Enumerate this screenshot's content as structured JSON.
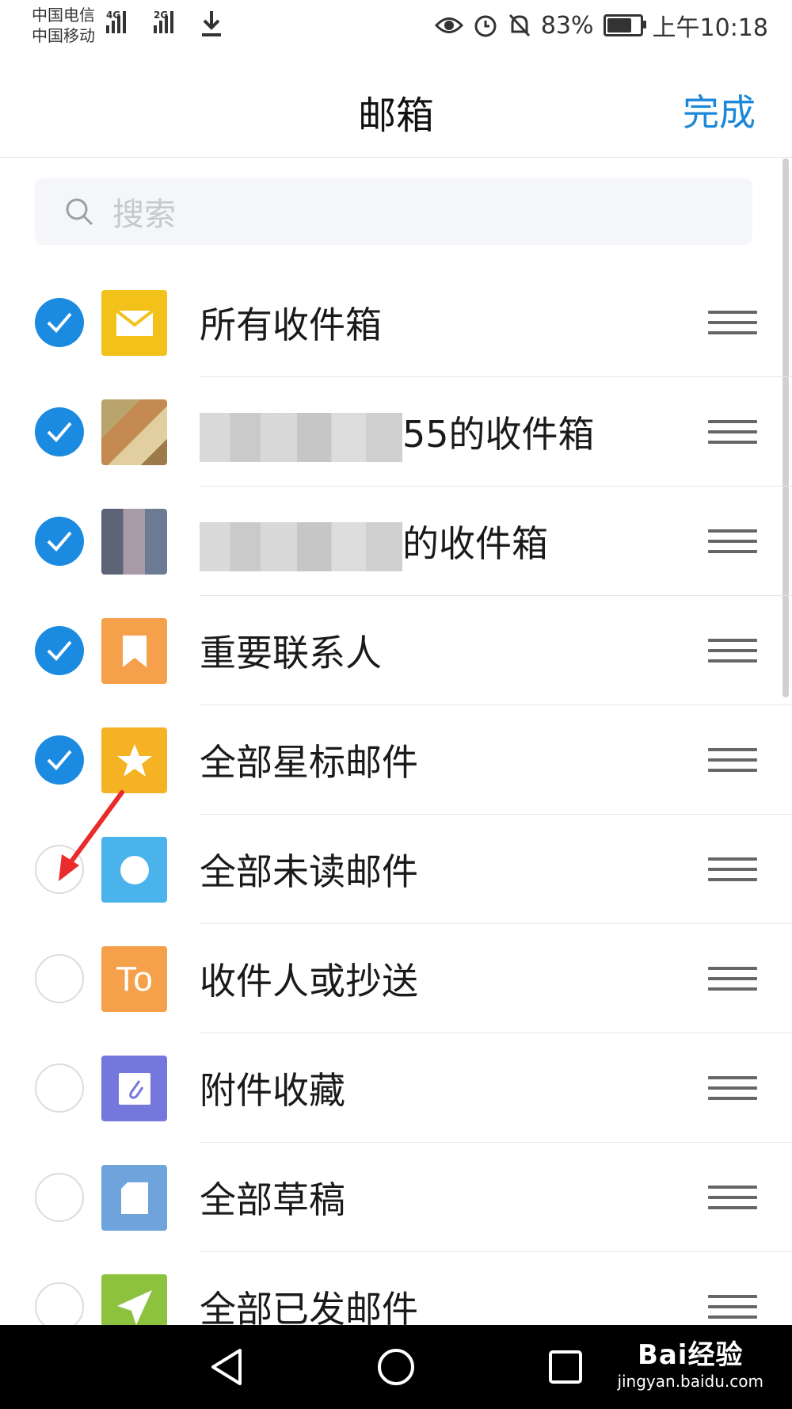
{
  "status_bar": {
    "carrier_1": "中国电信",
    "carrier_2": "中国移动",
    "net_1": "4G",
    "net_2": "2G",
    "battery": "83%",
    "battery_level": 0.83,
    "time": "上午10:18"
  },
  "header": {
    "title": "邮箱",
    "done_label": "完成"
  },
  "search": {
    "placeholder": "搜索"
  },
  "mailboxes": [
    {
      "label": "所有收件箱",
      "checked": true,
      "icon": "envelope-icon",
      "icon_color": "#f2c21b"
    },
    {
      "label": "55的收件箱",
      "checked": true,
      "icon": "avatar-photo-1",
      "icon_color": "#c8a46a",
      "redacted": true
    },
    {
      "label": "的收件箱",
      "checked": true,
      "icon": "avatar-photo-2",
      "icon_color": "#8a8fa6",
      "redacted": true
    },
    {
      "label": "重要联系人",
      "checked": true,
      "icon": "bookmark-icon",
      "icon_color": "#f5a04a"
    },
    {
      "label": "全部星标邮件",
      "checked": true,
      "icon": "star-icon",
      "icon_color": "#f5b323"
    },
    {
      "label": "全部未读邮件",
      "checked": false,
      "icon": "dot-icon",
      "icon_color": "#4ab3ec"
    },
    {
      "label": "收件人或抄送",
      "checked": false,
      "icon": "to-icon",
      "icon_text": "To",
      "icon_color": "#f5a04a"
    },
    {
      "label": "附件收藏",
      "checked": false,
      "icon": "paperclip-icon",
      "icon_color": "#7477db"
    },
    {
      "label": "全部草稿",
      "checked": false,
      "icon": "draft-icon",
      "icon_color": "#6fa3dc"
    },
    {
      "label": "全部已发邮件",
      "checked": false,
      "icon": "send-icon",
      "icon_color": "#8dc23f"
    }
  ],
  "watermark": {
    "brand": "Bai经验",
    "url": "jingyan.baidu.com"
  }
}
